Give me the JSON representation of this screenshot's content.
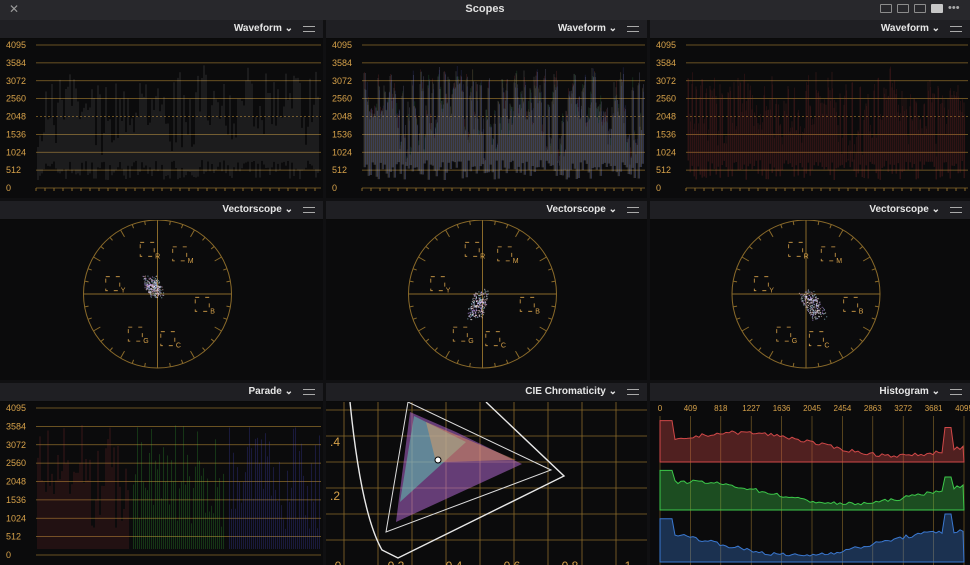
{
  "window": {
    "title": "Scopes",
    "close_icon": "close-icon"
  },
  "layouts": [
    "single-view-icon",
    "dual-view-icon",
    "quad-view-icon",
    "grid-view-icon",
    "more-options-icon"
  ],
  "more_label": "•••",
  "colors": {
    "accent": "#d7a24a",
    "grid": "#8a6a2a",
    "panel": "#0b0b0c",
    "header": "#1f1f23"
  },
  "panels": [
    {
      "title": "Waveform",
      "kind": "waveform",
      "tint": "white"
    },
    {
      "title": "Waveform",
      "kind": "waveform",
      "tint": "rgb"
    },
    {
      "title": "Waveform",
      "kind": "waveform",
      "tint": "red"
    },
    {
      "title": "Vectorscope",
      "kind": "vectorscope"
    },
    {
      "title": "Vectorscope",
      "kind": "vectorscope"
    },
    {
      "title": "Vectorscope",
      "kind": "vectorscope"
    },
    {
      "title": "Parade",
      "kind": "parade"
    },
    {
      "title": "CIE Chromaticity",
      "kind": "cie"
    },
    {
      "title": "Histogram",
      "kind": "histogram"
    }
  ],
  "waveform_scale": [
    "4095",
    "3584",
    "3072",
    "2560",
    "2048",
    "1536",
    "1024",
    "512",
    "0"
  ],
  "vector_targets": [
    "R",
    "M",
    "B",
    "C",
    "G",
    "Y"
  ],
  "cie_y_ticks": [
    ".4",
    ".2"
  ],
  "cie_x_ticks": [
    "0",
    "0.2",
    "0.4",
    "0.6",
    "0.8",
    "1"
  ],
  "histogram_ticks": [
    "0",
    "409",
    "818",
    "1227",
    "1636",
    "2045",
    "2454",
    "2863",
    "3272",
    "3681",
    "4095"
  ]
}
